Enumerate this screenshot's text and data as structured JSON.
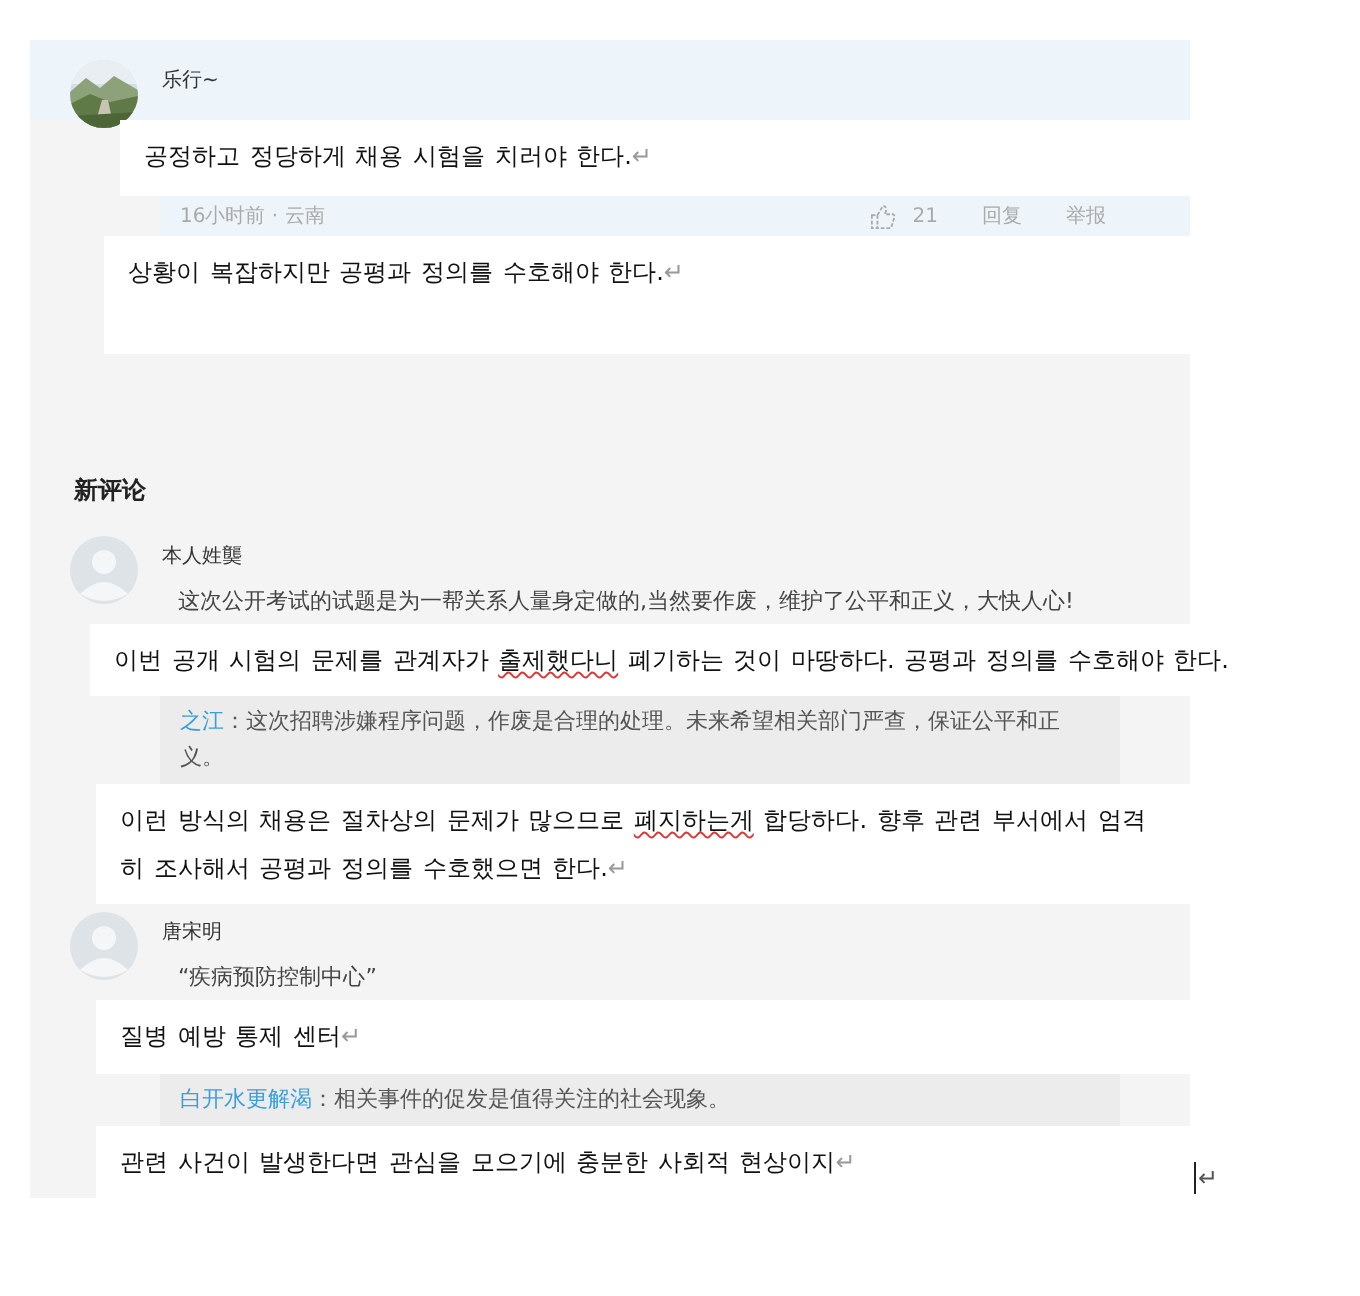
{
  "items": [
    {
      "kind": "comment",
      "author": "乐行~",
      "highlighted": true
    },
    {
      "kind": "translation",
      "parts": [
        {
          "text": "공정하고 정당하게 채용 시험을 치러야 한다.",
          "flagged": false
        }
      ],
      "return_mark": "↵"
    },
    {
      "kind": "meta",
      "time": "16小时前 · 云南",
      "likes": "21",
      "actions": [
        "回复",
        "举报"
      ]
    },
    {
      "kind": "translation",
      "parts": [
        {
          "text": "상황이 복잡하지만 공평과 정의를 수호해야 한다.",
          "flagged": false
        }
      ],
      "return_mark": "↵"
    },
    {
      "kind": "heading",
      "text": "新评论"
    },
    {
      "kind": "comment",
      "author": "本人姓龑",
      "avatar": {
        "kind": "silhouette"
      },
      "highlighted": false,
      "text": "这次公开考试的试题是为一帮关系人量身定做的,当然要作废，维护了公平和正义，大快人心!"
    },
    {
      "kind": "translation",
      "parts": [
        {
          "text": "이번 공개 시험의 문제를 관계자가 ",
          "flagged": false
        },
        {
          "text": "출제했다니",
          "flagged": true
        },
        {
          "text": " 폐기하는 것이 마땅하다. 공평과 정의를 수호해야 한다.",
          "flagged": false
        }
      ]
    },
    {
      "kind": "reply",
      "author": "之江",
      "text": "：这次招聘涉嫌程序问题，作废是合理的处理。未来希望相关部门严查，保证公平和正义。"
    },
    {
      "kind": "translation",
      "parts": [
        {
          "text": "이런 방식의 채용은 절차상의 문제가 많으므로 ",
          "flagged": false
        },
        {
          "text": "폐지하는게",
          "flagged": true
        },
        {
          "text": " 합당하다. 향후 관련 부서에서 엄격히 조사해서 공평과 정의를 수호했으면 한다.",
          "flagged": false
        }
      ],
      "return_mark": "↵"
    },
    {
      "kind": "comment",
      "author": "唐宋明",
      "avatar": {
        "kind": "silhouette"
      },
      "highlighted": false,
      "text": "“疾病预防控制中心”"
    },
    {
      "kind": "translation",
      "parts": [
        {
          "text": "질병 예방 통제 센터",
          "flagged": false
        }
      ],
      "return_mark": "↵"
    },
    {
      "kind": "reply",
      "author": "白开水更解渴",
      "text": "：相关事件的促发是值得关注的社会现象。"
    },
    {
      "kind": "translation",
      "parts": [
        {
          "text": "관련 사건이 발생한다면 관심을 모으기에 충분한 사회적 현상이지",
          "flagged": false
        }
      ],
      "return_mark": "↵",
      "trailing_mark": "↵"
    }
  ]
}
